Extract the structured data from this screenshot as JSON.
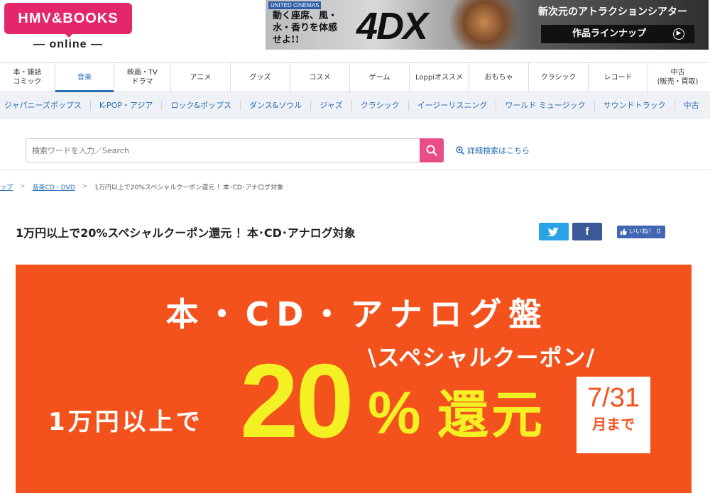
{
  "header": {
    "logo_text": "HMV&BOOKS",
    "logo_sub": "— online —",
    "banner": {
      "brand": "UNITED CINEMAS",
      "copy": "動く座席、風・水・香りを体感せよ!!",
      "logo": "4DX",
      "headline": "新次元のアトラクションシアター",
      "button": "作品ラインナップ"
    }
  },
  "main_nav": [
    {
      "label": "本・雑誌\nコミック"
    },
    {
      "label": "音楽",
      "active": true
    },
    {
      "label": "映画・TV\nドラマ"
    },
    {
      "label": "アニメ"
    },
    {
      "label": "グッズ"
    },
    {
      "label": "コスメ"
    },
    {
      "label": "ゲーム"
    },
    {
      "label": "Loppiオススメ"
    },
    {
      "label": "おもちゃ"
    },
    {
      "label": "クラシック"
    },
    {
      "label": "レコード"
    },
    {
      "label": "中古\n(販売・買取)"
    }
  ],
  "sub_nav": [
    "ジャパニーズポップス",
    "K-POP・アジア",
    "ロック&ポップス",
    "ダンス&ソウル",
    "ジャズ",
    "クラシック",
    "イージーリスニング",
    "ワールド ミュージック",
    "サウンドトラック",
    "中古"
  ],
  "search": {
    "placeholder": "検索ワードを入力／Search",
    "advanced_label": "詳細検索はこちら"
  },
  "breadcrumb": {
    "items": [
      "ップ",
      "音楽CD・DVD"
    ],
    "current": "1万円以上で20%スペシャルクーポン還元 ！本･CD･アナログ対象",
    "separator": ">"
  },
  "page": {
    "title": "1万円以上で20%スペシャルクーポン還元 ！本･CD･アナログ対象",
    "facebook_label": "f",
    "like_label": "いいね！ 0"
  },
  "campaign": {
    "headline": "本・CD・アナログ盤",
    "subhead": "\\スペシャルクーポン/",
    "condition": "1万円以上で",
    "percent": "20",
    "percent_sign": "%",
    "reward": "還元",
    "date": "7/31",
    "until": "月まで",
    "colors": {
      "background": "#f4521c",
      "accent": "#f3f024"
    }
  }
}
